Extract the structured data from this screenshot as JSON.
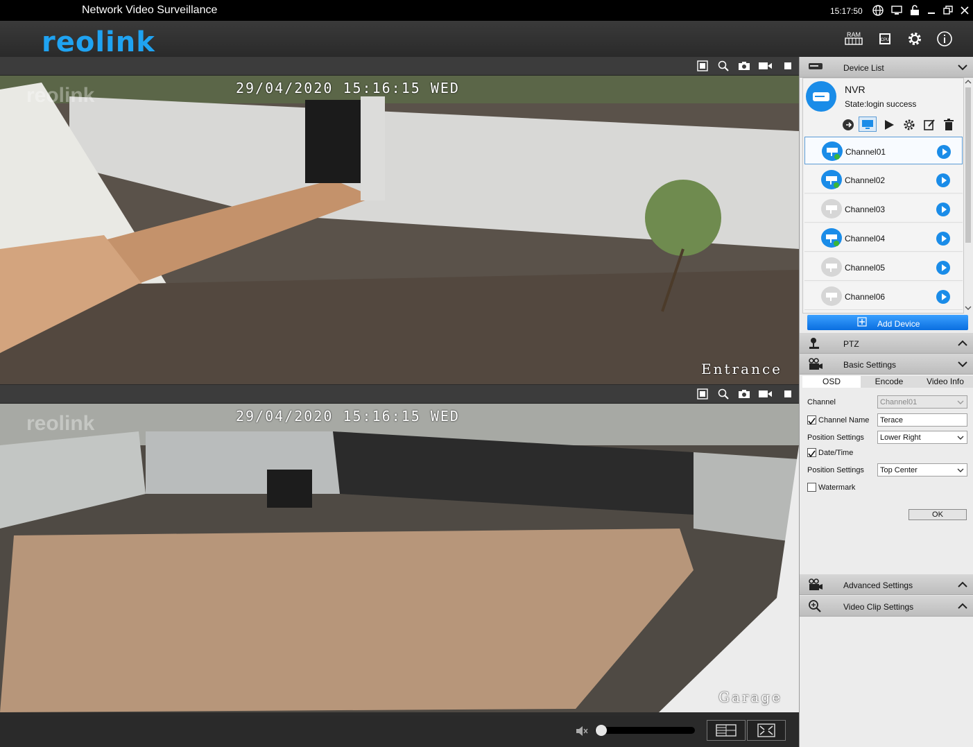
{
  "window": {
    "title": "Network Video Surveillance",
    "clock": "15:17:50"
  },
  "header": {
    "logo": "reolink",
    "ram_label": "RAM",
    "cpu_label": "CPU"
  },
  "panes": [
    {
      "osd_datetime": "29/04/2020 15:16:15 WED",
      "osd_name": "Entrance",
      "watermark": "reolink"
    },
    {
      "osd_datetime": "29/04/2020 15:16:15 WED",
      "osd_name": "Garage",
      "watermark": "reolink"
    }
  ],
  "sidebar": {
    "device_list_label": "Device List",
    "device": {
      "name": "NVR",
      "state": "State:login success"
    },
    "channels": [
      {
        "name": "Channel01",
        "online": true
      },
      {
        "name": "Channel02",
        "online": true
      },
      {
        "name": "Channel03",
        "online": false
      },
      {
        "name": "Channel04",
        "online": true
      },
      {
        "name": "Channel05",
        "online": false
      },
      {
        "name": "Channel06",
        "online": false
      }
    ],
    "add_device_label": "Add Device",
    "ptz_label": "PTZ",
    "basic_settings_label": "Basic Settings",
    "tabs": [
      "OSD",
      "Encode",
      "Video Info"
    ],
    "osd": {
      "channel_label": "Channel",
      "channel_value": "Channel01",
      "channel_name_label": "Channel Name",
      "channel_name_value": "Terace",
      "position_label_1": "Position Settings",
      "position_value_1": "Lower Right",
      "datetime_label": "Date/Time",
      "position_label_2": "Position Settings",
      "position_value_2": "Top Center",
      "watermark_label": "Watermark",
      "ok_label": "OK"
    },
    "advanced_settings_label": "Advanced Settings",
    "video_clip_settings_label": "Video Clip Settings"
  },
  "colors": {
    "accent": "#1a8ce8",
    "logo": "#1fa3f2"
  }
}
